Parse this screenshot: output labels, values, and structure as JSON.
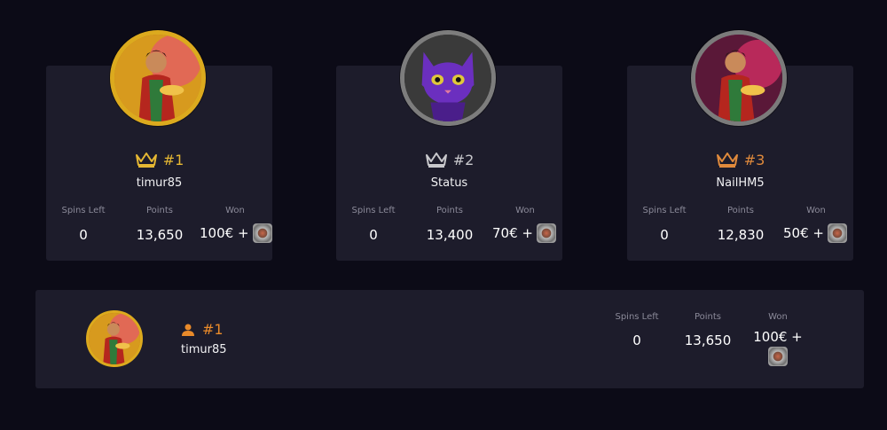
{
  "podium": [
    {
      "rank": "#1",
      "tier": "gold",
      "username": "timur85",
      "spins_left": "0",
      "points": "13,650",
      "won": "100€ +"
    },
    {
      "rank": "#2",
      "tier": "silver",
      "username": "Status",
      "spins_left": "0",
      "points": "13,400",
      "won": "70€ +"
    },
    {
      "rank": "#3",
      "tier": "bronze",
      "username": "NailHM5",
      "spins_left": "0",
      "points": "12,830",
      "won": "50€ +"
    }
  ],
  "labels": {
    "spins_left": "Spins Left",
    "points": "Points",
    "won": "Won"
  },
  "current_user": {
    "rank": "#1",
    "username": "timur85",
    "spins_left": "0",
    "points": "13,650",
    "won": "100€ +"
  },
  "colors": {
    "gold": "#e5b733",
    "silver": "#c8c8cc",
    "bronze": "#e08a3c",
    "user_accent": "#e98a2a",
    "card_bg": "#1d1c2b",
    "page_bg": "#0c0b17"
  },
  "icons": {
    "rank_icon": "crown-icon",
    "user_icon": "user-icon",
    "prize_icon": "prize-chip-icon"
  }
}
